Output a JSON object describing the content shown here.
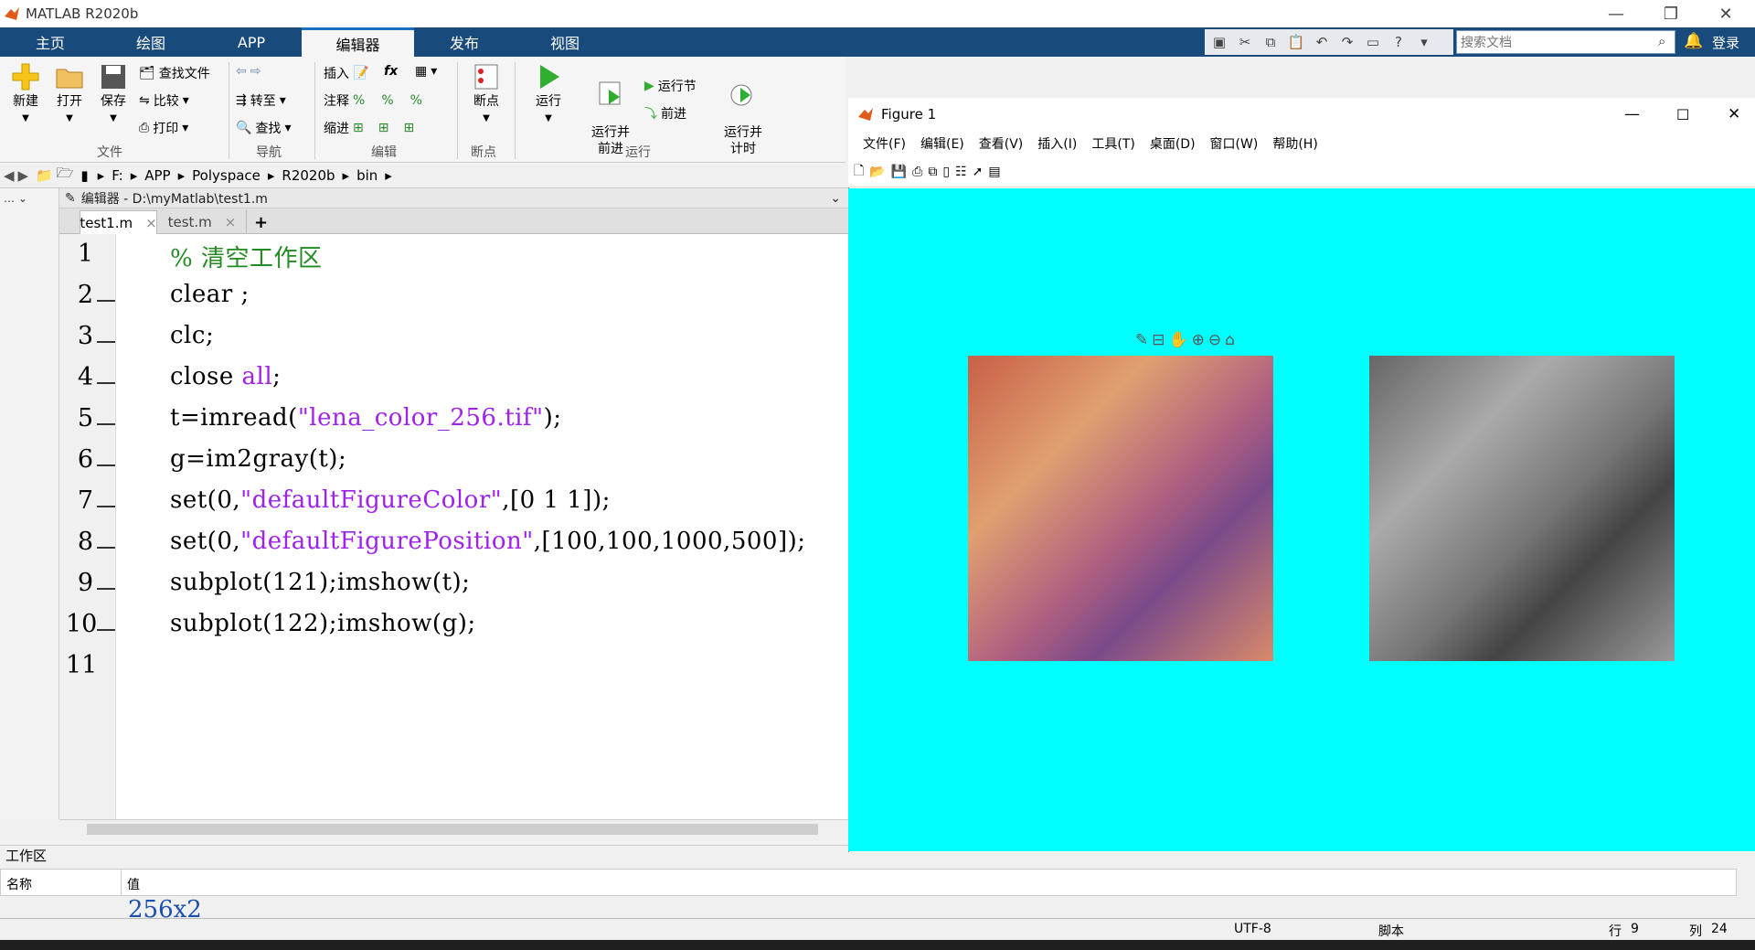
{
  "app": {
    "title": "MATLAB R2020b",
    "login": "登录"
  },
  "tabs": [
    "主页",
    "绘图",
    "APP",
    "编辑器",
    "发布",
    "视图"
  ],
  "search": {
    "placeholder": "搜索文档"
  },
  "ribbon": {
    "new": "新建",
    "open": "打开",
    "save": "保存",
    "find_files": "查找文件",
    "compare": "比较",
    "print": "打印",
    "goto": "转至",
    "find": "查找",
    "insert": "插入",
    "comment": "注释",
    "indent": "缩进",
    "fx": "fx",
    "breakpoint": "断点",
    "run": "运行",
    "run_advance": "运行并\n前进",
    "run_section": "运行节",
    "advance": "前进",
    "run_time": "运行并\n计时",
    "groups": {
      "file": "文件",
      "nav": "导航",
      "edit": "编辑",
      "bp": "断点",
      "run": "运行"
    }
  },
  "address": {
    "parts": [
      "F:",
      "APP",
      "Polyspace",
      "R2020b",
      "bin"
    ]
  },
  "editor": {
    "header": "编辑器 - D:\\myMatlab\\test1.m",
    "tabs": [
      "test1.m",
      "test.m"
    ],
    "lines": [
      {
        "n": "1",
        "seg": [
          {
            "t": "% 清空工作区",
            "c": "cm"
          }
        ],
        "dash": false
      },
      {
        "n": "2",
        "seg": [
          {
            "t": "clear ;",
            "c": ""
          }
        ],
        "dash": true
      },
      {
        "n": "3",
        "seg": [
          {
            "t": "clc;",
            "c": ""
          }
        ],
        "dash": true
      },
      {
        "n": "4",
        "seg": [
          {
            "t": "close ",
            "c": ""
          },
          {
            "t": "all",
            "c": "st"
          },
          {
            "t": ";",
            "c": ""
          }
        ],
        "dash": true
      },
      {
        "n": "5",
        "seg": [
          {
            "t": "t=imread(",
            "c": ""
          },
          {
            "t": "\"lena_color_256.tif\"",
            "c": "st"
          },
          {
            "t": ");",
            "c": ""
          }
        ],
        "dash": true
      },
      {
        "n": "6",
        "seg": [
          {
            "t": "g=im2gray(t);",
            "c": ""
          }
        ],
        "dash": true
      },
      {
        "n": "7",
        "seg": [
          {
            "t": "set(0,",
            "c": ""
          },
          {
            "t": "\"defaultFigureColor\"",
            "c": "st"
          },
          {
            "t": ",[0 1 1]);",
            "c": ""
          }
        ],
        "dash": true
      },
      {
        "n": "8",
        "seg": [
          {
            "t": "set(0,",
            "c": ""
          },
          {
            "t": "\"defaultFigurePosition\"",
            "c": "st"
          },
          {
            "t": ",[100,100,1000,500]);",
            "c": ""
          }
        ],
        "dash": true
      },
      {
        "n": "9",
        "seg": [
          {
            "t": "subplot(121);imshow(t);",
            "c": ""
          }
        ],
        "dash": true
      },
      {
        "n": "10",
        "seg": [
          {
            "t": "subplot(122);imshow(g);",
            "c": ""
          }
        ],
        "dash": true
      },
      {
        "n": "11",
        "seg": [],
        "dash": false
      }
    ]
  },
  "workspace": {
    "title": "工作区",
    "col_name": "名称",
    "col_value": "值",
    "partial_value": "256x2"
  },
  "status": {
    "encoding": "UTF-8",
    "type": "脚本",
    "row_label": "行",
    "row": "9",
    "col_label": "列",
    "col": "24"
  },
  "figure": {
    "title": "Figure 1",
    "menu": [
      "文件(F)",
      "编辑(E)",
      "查看(V)",
      "插入(I)",
      "工具(T)",
      "桌面(D)",
      "窗口(W)",
      "帮助(H)"
    ],
    "canvas_color": "#00ffff"
  }
}
